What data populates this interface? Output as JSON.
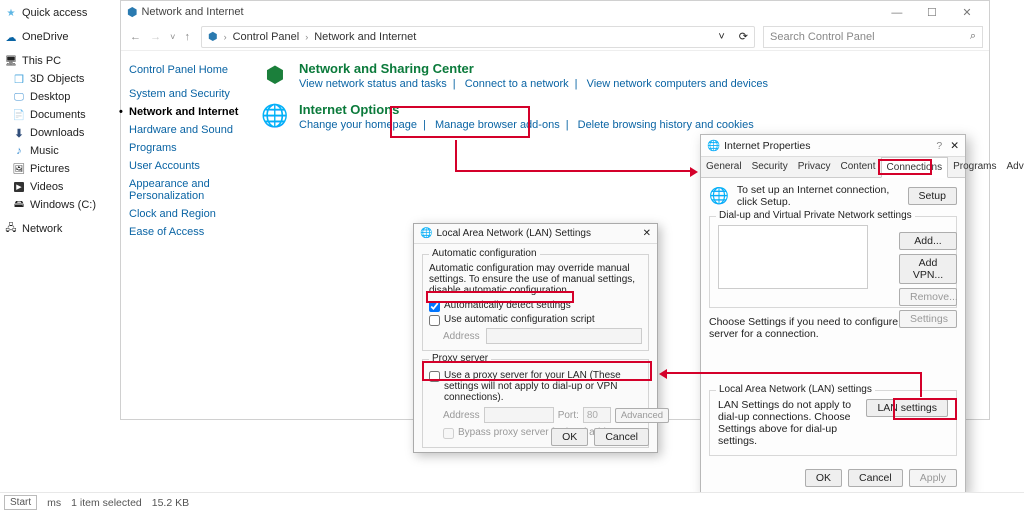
{
  "nav": {
    "items": [
      {
        "label": "Quick access"
      },
      {
        "label": "OneDrive"
      },
      {
        "label": "This PC"
      },
      {
        "label": "3D Objects"
      },
      {
        "label": "Desktop"
      },
      {
        "label": "Documents"
      },
      {
        "label": "Downloads"
      },
      {
        "label": "Music"
      },
      {
        "label": "Pictures"
      },
      {
        "label": "Videos"
      },
      {
        "label": "Windows (C:)"
      },
      {
        "label": "Network"
      }
    ]
  },
  "explorer": {
    "title": "Network and Internet",
    "breadcrumb": [
      "Control Panel",
      "Network and Internet"
    ],
    "search_placeholder": "Search Control Panel",
    "refresh_glyph": "⟳",
    "dropdown_glyph": "˅",
    "side": [
      "Control Panel Home",
      "System and Security",
      "Network and Internet",
      "Hardware and Sound",
      "Programs",
      "User Accounts",
      "Appearance and Personalization",
      "Clock and Region",
      "Ease of Access"
    ],
    "cat1": {
      "title": "Network and Sharing Center",
      "links": [
        "View network status and tasks",
        "Connect to a network",
        "View network computers and devices"
      ]
    },
    "cat2": {
      "title": "Internet Options",
      "links": [
        "Change your homepage",
        "Manage browser add-ons",
        "Delete browsing history and cookies"
      ]
    }
  },
  "ip": {
    "title": "Internet Properties",
    "tabs": [
      "General",
      "Security",
      "Privacy",
      "Content",
      "Connections",
      "Programs",
      "Advanced"
    ],
    "setup_text": "To set up an Internet connection, click Setup.",
    "setup_btn": "Setup",
    "dial_legend": "Dial-up and Virtual Private Network settings",
    "add_btn": "Add...",
    "addvpn_btn": "Add VPN...",
    "remove_btn": "Remove...",
    "settings_btn": "Settings",
    "choose_text": "Choose Settings if you need to configure a proxy server for a connection.",
    "lan_legend": "Local Area Network (LAN) settings",
    "lan_text": "LAN Settings do not apply to dial-up connections. Choose Settings above for dial-up settings.",
    "lan_btn": "LAN settings",
    "ok": "OK",
    "cancel": "Cancel",
    "apply": "Apply"
  },
  "lan": {
    "title": "Local Area Network (LAN) Settings",
    "auto_legend": "Automatic configuration",
    "auto_desc": "Automatic configuration may override manual settings. To ensure the use of manual settings, disable automatic configuration.",
    "auto_detect": "Automatically detect settings",
    "auto_script": "Use automatic configuration script",
    "addr_label": "Address",
    "proxy_legend": "Proxy server",
    "proxy_use": "Use a proxy server for your LAN (These settings will not apply to dial-up or VPN connections).",
    "port_label": "Port:",
    "port_val": "80",
    "adv_btn": "Advanced",
    "bypass": "Bypass proxy server for local addresses",
    "ok": "OK",
    "cancel": "Cancel"
  },
  "status": {
    "start": "Start",
    "items": "ms",
    "sel": "1 item selected",
    "size": "15.2 KB"
  }
}
